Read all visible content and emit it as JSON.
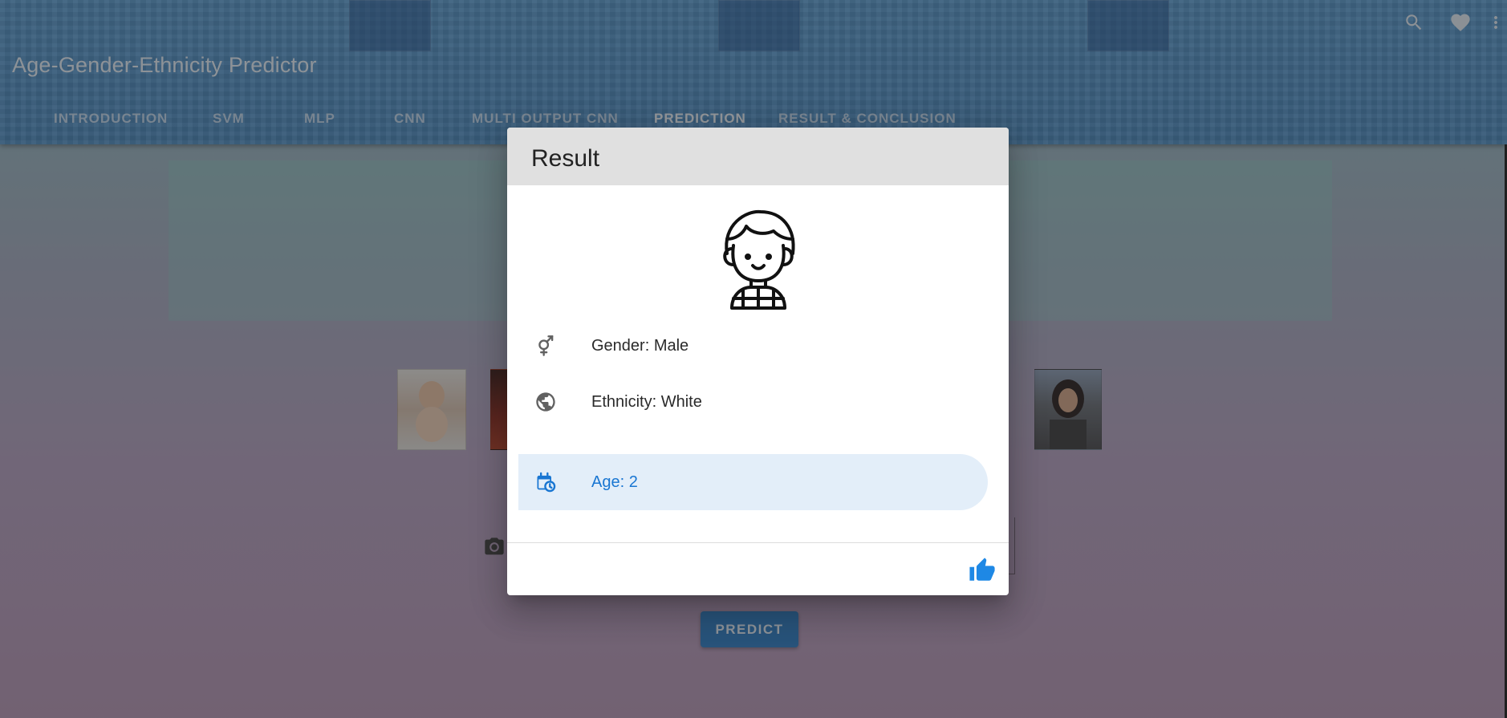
{
  "app": {
    "title": "Age-Gender-Ethnicity Predictor"
  },
  "tabs": [
    {
      "label": "INTRODUCTION"
    },
    {
      "label": "SVM"
    },
    {
      "label": "MLP"
    },
    {
      "label": "CNN"
    },
    {
      "label": "MULTI OUTPUT CNN"
    },
    {
      "label": "PREDICTION",
      "active": true
    },
    {
      "label": "RESULT & CONCLUSION"
    }
  ],
  "toolbar_icons": [
    "search-icon",
    "heart-icon",
    "dots-vertical-icon"
  ],
  "page": {
    "predict_label": "PREDICT",
    "camera_icon": "camera-icon"
  },
  "dialog": {
    "title": "Result",
    "avatar_icon": "boy-avatar-icon",
    "items": [
      {
        "icon": "gender-icon",
        "text": "Gender: Male"
      },
      {
        "icon": "globe-icon",
        "text": "Ethnicity: White"
      },
      {
        "icon": "calendar-clock-icon",
        "text": "Age: 2",
        "active": true
      }
    ],
    "action_icon": "thumb-up-icon"
  },
  "colors": {
    "primary": "#1976d2",
    "appbar": "#4e92cc",
    "active_item_bg": "#e3eef9",
    "dialog_header": "#e0e0e0"
  }
}
